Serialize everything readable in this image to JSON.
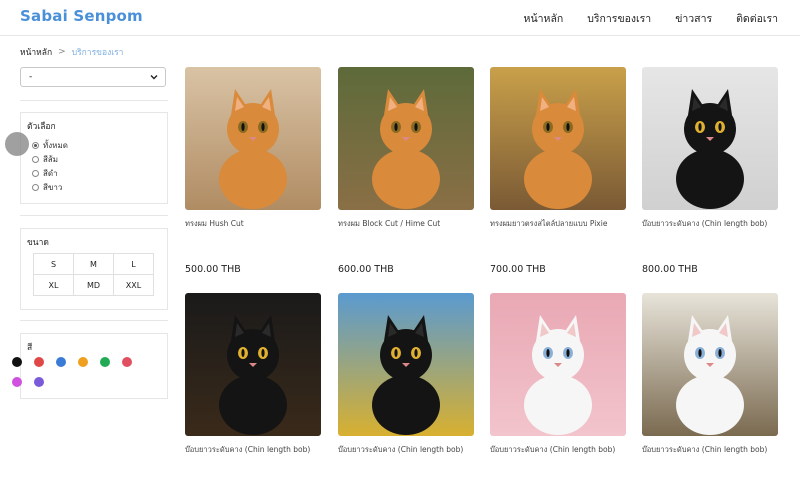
{
  "header": {
    "brand": "Sabai Senpom",
    "nav": [
      "หน้าหลัก",
      "บริการของเรา",
      "ข่าวสาร",
      "ติดต่อเรา"
    ]
  },
  "breadcrumb": {
    "home": "หน้าหลัก",
    "separator": ">",
    "current": "บริการของเรา"
  },
  "sidebar": {
    "select_value": "-",
    "options_title": "ตัวเลือก",
    "options": [
      {
        "label": "ทั้งหมด",
        "checked": true
      },
      {
        "label": "สีส้ม",
        "checked": false
      },
      {
        "label": "สีดำ",
        "checked": false
      },
      {
        "label": "สีขาว",
        "checked": false
      }
    ],
    "size_title": "ขนาด",
    "sizes": [
      "S",
      "M",
      "L",
      "XL",
      "MD",
      "XXL"
    ],
    "color_title": "สี",
    "colors": [
      "#111111",
      "#e04848",
      "#3a7bd5",
      "#f0a020",
      "#22aa55",
      "#e05060",
      "#d050e0",
      "#7a5ad8"
    ]
  },
  "products": [
    {
      "name": "ทรงผม Hush Cut",
      "price": "500.00 THB",
      "icon": "orange-cat-image"
    },
    {
      "name": "ทรงผม Block Cut / Hime Cut",
      "price": "600.00 THB",
      "icon": "orange-cat-image"
    },
    {
      "name": "ทรงผมยาวตรงสไตล์ปลายแบบ Pixie",
      "price": "700.00 THB",
      "icon": "orange-cat-image"
    },
    {
      "name": "บ๊อบยาวระดับคาง (Chin length bob)",
      "price": "800.00 THB",
      "icon": "black-cat-image"
    },
    {
      "name": "บ๊อบยาวระดับคาง (Chin length bob)",
      "price": "",
      "icon": "black-cat-image"
    },
    {
      "name": "บ๊อบยาวระดับคาง (Chin length bob)",
      "price": "",
      "icon": "black-cat-image"
    },
    {
      "name": "บ๊อบยาวระดับคาง (Chin length bob)",
      "price": "",
      "icon": "white-cat-image"
    },
    {
      "name": "บ๊อบยาวระดับคาง (Chin length bob)",
      "price": "",
      "icon": "white-cat-image"
    }
  ]
}
